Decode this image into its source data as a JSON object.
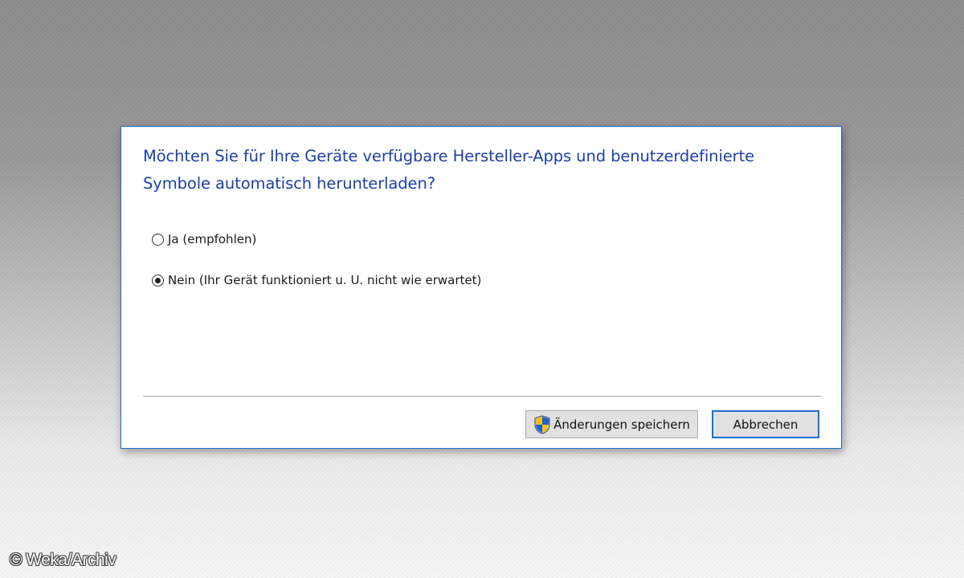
{
  "dialog": {
    "question": "Möchten Sie für Ihre Geräte verfügbare Hersteller-Apps und benutzerdefinierte Symbole automatisch herunterladen?",
    "options": [
      {
        "label": "Ja (empfohlen)",
        "selected": false
      },
      {
        "label": "Nein (Ihr Gerät funktioniert u. U. nicht wie erwartet)",
        "selected": true
      }
    ],
    "buttons": {
      "save_label": "Änderungen speichern",
      "save_icon": "uac-shield-icon",
      "cancel_label": "Abbrechen"
    }
  },
  "watermark": "© Weka/Archiv",
  "colors": {
    "question_text": "#1c3fa8",
    "dialog_border": "#1c6fd1",
    "focus_border": "#1c6fd1",
    "button_face": "#e1e1e1"
  }
}
